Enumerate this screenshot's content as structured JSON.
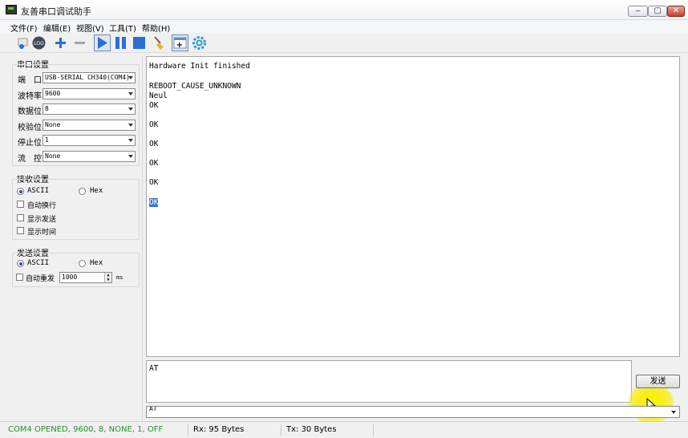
{
  "window": {
    "title": "友善串口调试助手",
    "minimize": "‒",
    "maximize": "▢",
    "close": "✕"
  },
  "menu": [
    "文件(F)",
    "编辑(E)",
    "视图(V)",
    "工具(T)",
    "帮助(H)"
  ],
  "toolbar": {
    "icons": [
      "connect-icon",
      "log-icon",
      "add-icon",
      "remove-icon",
      "play-icon",
      "pause-icon",
      "stop-icon",
      "clear-broom-icon",
      "new-window-icon",
      "settings-gear-icon"
    ],
    "log_label": "LOG"
  },
  "serial_settings": {
    "title": "串口设置",
    "port_label": "端　口",
    "port_value": "USB-SERIAL CH340(COM4)",
    "baud_label": "波特率",
    "baud_value": "9600",
    "databits_label": "数据位",
    "databits_value": "8",
    "parity_label": "校验位",
    "parity_value": "None",
    "stopbits_label": "停止位",
    "stopbits_value": "1",
    "flow_label": "流　控",
    "flow_value": "None"
  },
  "receive_settings": {
    "title": "接收设置",
    "ascii": "ASCII",
    "hex": "Hex",
    "auto_newline": "自动换行",
    "show_sent": "显示发送",
    "show_time": "显示时间"
  },
  "send_settings": {
    "title": "发送设置",
    "ascii": "ASCII",
    "hex": "Hex",
    "auto_resend": "自动重发",
    "interval": "1000",
    "unit": "ms"
  },
  "receive_lines": [
    "Hardware Init finished",
    "",
    "REBOOT_CAUSE_UNKNOWN",
    "Neul",
    "OK",
    "",
    "OK",
    "",
    "OK",
    "",
    "OK",
    "",
    "OK",
    "",
    "OK"
  ],
  "send_text": "AT",
  "send_button": "发送",
  "history_value": "AT",
  "status": {
    "connection": "COM4 OPENED, 9600, 8, NONE, 1, OFF",
    "rx": "Rx: 95 Bytes",
    "tx": "Tx: 30 Bytes"
  },
  "colors": {
    "status_green": "#2e8b2e",
    "selection_blue": "#3a74d8",
    "toolbar_blue": "#2b6fd6"
  }
}
